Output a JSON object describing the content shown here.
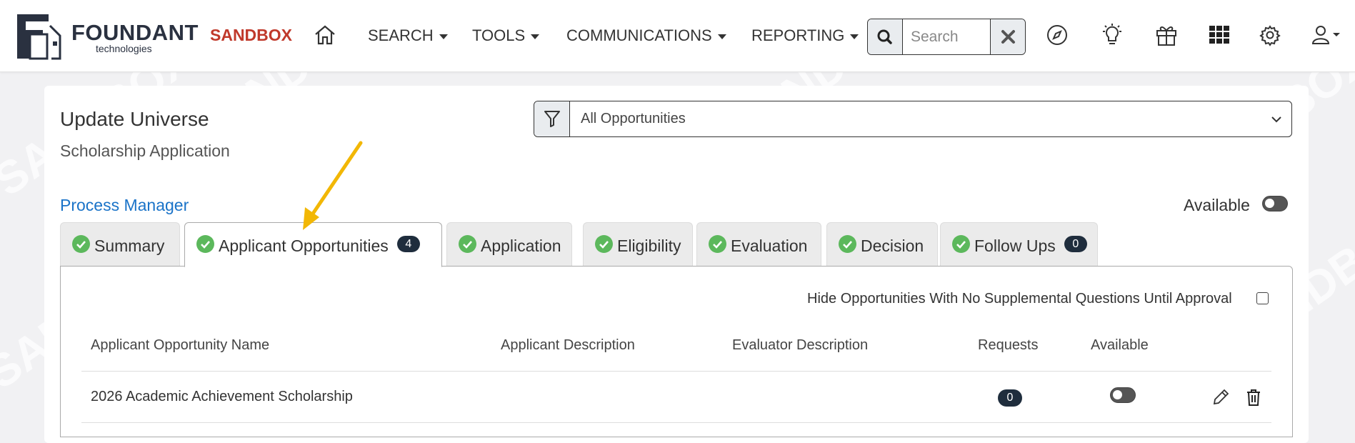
{
  "brand": {
    "name": "FOUNDANT",
    "sub": "technologies",
    "env": "SANDBOX"
  },
  "watermark": "SANDBOX",
  "nav": {
    "items": [
      {
        "label": "SEARCH",
        "icon": "caret-down-icon"
      },
      {
        "label": "TOOLS",
        "icon": "caret-down-icon"
      },
      {
        "label": "COMMUNICATIONS",
        "icon": "caret-down-icon"
      },
      {
        "label": "REPORTING",
        "icon": "caret-down-icon"
      }
    ],
    "search": {
      "placeholder": "Search",
      "value": ""
    },
    "icons": [
      "home-icon",
      "search-icon",
      "close-icon",
      "compass-icon",
      "lightbulb-icon",
      "gift-icon",
      "apps-grid-icon",
      "gear-icon",
      "user-icon",
      "caret-down-icon"
    ]
  },
  "page": {
    "title": "Update Universe",
    "subtitle": "Scholarship Application",
    "filter": {
      "selected": "All Opportunities",
      "icon": "filter-icon"
    },
    "process_manager": "Process Manager",
    "available_label": "Available"
  },
  "tabs": [
    {
      "label": "Summary",
      "badge": null,
      "active": false
    },
    {
      "label": "Applicant Opportunities",
      "badge": "4",
      "active": true
    },
    {
      "label": "Application",
      "badge": null,
      "active": false
    },
    {
      "label": "Eligibility",
      "badge": null,
      "active": false
    },
    {
      "label": "Evaluation",
      "badge": null,
      "active": false
    },
    {
      "label": "Decision",
      "badge": null,
      "active": false
    },
    {
      "label": "Follow Ups",
      "badge": "0",
      "active": false
    }
  ],
  "panel": {
    "hide_option": "Hide Opportunities With No Supplemental Questions Until Approval",
    "columns": [
      "Applicant Opportunity Name",
      "Applicant Description",
      "Evaluator Description",
      "Requests",
      "Available"
    ],
    "rows": [
      {
        "name": "2026 Academic Achievement Scholarship",
        "applicant_description": "",
        "evaluator_description": "",
        "requests": "0",
        "available": false
      }
    ]
  },
  "colors": {
    "sandbox": "#c0392b",
    "link": "#1a73c8",
    "check": "#5cb85c",
    "badge": "#1f2d3d",
    "annotation_arrow": "#f2b705"
  }
}
